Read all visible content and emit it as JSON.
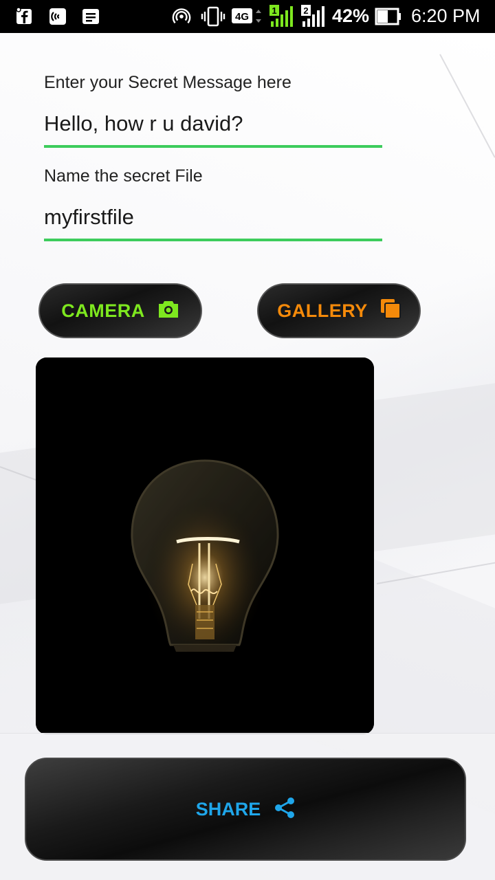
{
  "status_bar": {
    "battery_percent": "42%",
    "time": "6:20 PM",
    "network": "4G",
    "sim1": "1",
    "sim2": "2",
    "icons": [
      "facebook-notification-icon",
      "nfc-icon",
      "message-icon",
      "hotspot-icon",
      "vibrate-icon",
      "network-4g-icon",
      "signal-sim1-icon",
      "signal-sim2-icon",
      "battery-icon"
    ]
  },
  "form": {
    "message_label": "Enter your Secret Message here",
    "message_value": "Hello, how r u david?",
    "filename_label": "Name the secret File",
    "filename_value": "myfirstfile"
  },
  "buttons": {
    "camera_label": "CAMERA",
    "gallery_label": "GALLERY",
    "share_label": "SHARE"
  },
  "colors": {
    "accent_green": "#3dcc5c",
    "camera": "#7ee81f",
    "gallery": "#f58a0a",
    "share": "#1fa6ea"
  },
  "preview": {
    "image": "lightbulb-photo"
  }
}
